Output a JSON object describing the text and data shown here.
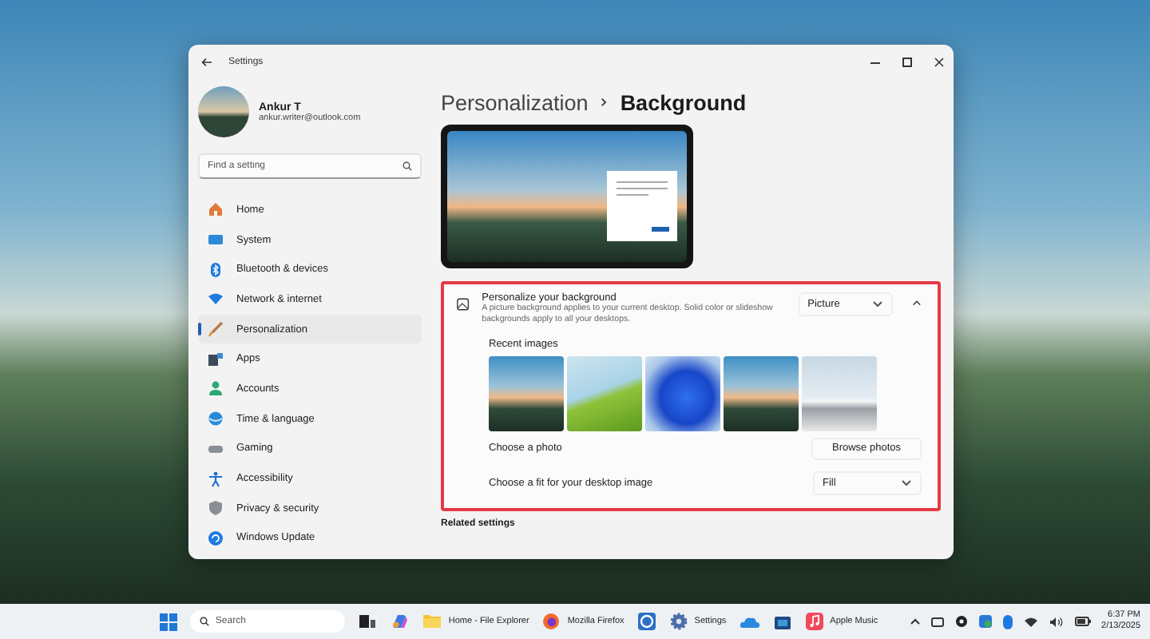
{
  "window": {
    "title": "Settings"
  },
  "account": {
    "name": "Ankur T",
    "email": "ankur.writer@outlook.com"
  },
  "search": {
    "placeholder": "Find a setting"
  },
  "sidebar": {
    "items": [
      {
        "label": "Home",
        "selected": false
      },
      {
        "label": "System",
        "selected": false
      },
      {
        "label": "Bluetooth & devices",
        "selected": false
      },
      {
        "label": "Network & internet",
        "selected": false
      },
      {
        "label": "Personalization",
        "selected": true
      },
      {
        "label": "Apps",
        "selected": false
      },
      {
        "label": "Accounts",
        "selected": false
      },
      {
        "label": "Time & language",
        "selected": false
      },
      {
        "label": "Gaming",
        "selected": false
      },
      {
        "label": "Accessibility",
        "selected": false
      },
      {
        "label": "Privacy & security",
        "selected": false
      },
      {
        "label": "Windows Update",
        "selected": false
      }
    ]
  },
  "breadcrumb": {
    "parent": "Personalization",
    "current": "Background"
  },
  "background_card": {
    "title": "Personalize your background",
    "description": "A picture background applies to your current desktop. Solid color or slideshow backgrounds apply to all your desktops.",
    "type_value": "Picture",
    "expanded": true,
    "recent_images_label": "Recent images",
    "recent_images": [
      {
        "kind": "mountain"
      },
      {
        "kind": "hill"
      },
      {
        "kind": "swirl"
      },
      {
        "kind": "mountain"
      },
      {
        "kind": "cars"
      }
    ],
    "photo_label": "Choose a photo",
    "browse_button": "Browse photos",
    "fit_label": "Choose a fit for your desktop image",
    "fit_value": "Fill"
  },
  "related_settings": "Related settings",
  "taskbar": {
    "search_placeholder": "Search",
    "apps": [
      {
        "kind": "taskview"
      },
      {
        "kind": "copilot"
      },
      {
        "kind": "explorer",
        "label": "Home - File Explorer"
      },
      {
        "kind": "firefox",
        "label": "Mozilla Firefox"
      },
      {
        "kind": "sapp"
      },
      {
        "kind": "settings",
        "label": "Settings"
      },
      {
        "kind": "cloud"
      },
      {
        "kind": "store"
      },
      {
        "kind": "music",
        "label": "Apple Music"
      }
    ],
    "time": "6:37 PM",
    "date": "2/13/2025"
  }
}
